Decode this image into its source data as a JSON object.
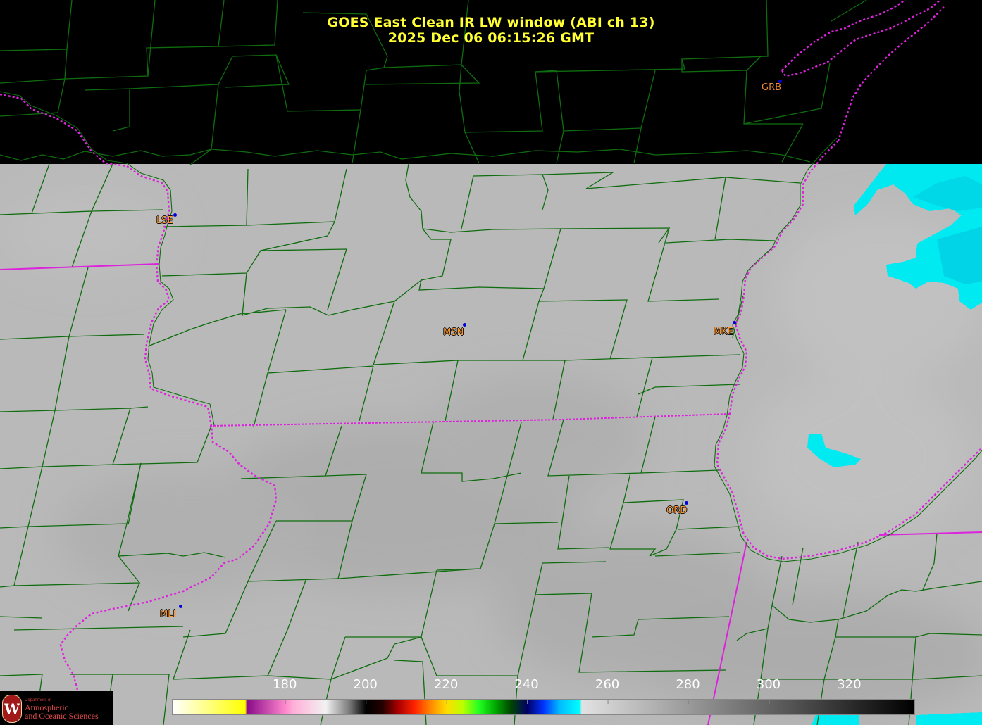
{
  "title": {
    "line1": "GOES East Clean IR LW window (ABI ch 13)",
    "line2": "2025 Dec 06  06:15:26 GMT"
  },
  "stations": [
    {
      "id": "GRB"
    },
    {
      "id": "LSE"
    },
    {
      "id": "MSN"
    },
    {
      "id": "MKE"
    },
    {
      "id": "ORD"
    },
    {
      "id": "MLI"
    }
  ],
  "colorbar": {
    "unit_range": [
      152,
      336
    ],
    "ticks": [
      "180",
      "200",
      "220",
      "240",
      "260",
      "280",
      "300",
      "320"
    ],
    "tick_values": [
      180,
      200,
      220,
      240,
      260,
      280,
      300,
      320
    ],
    "stops": [
      {
        "v": 152,
        "c": "#ffffff"
      },
      {
        "v": 170,
        "c": "#ffff00"
      },
      {
        "v": 170.5,
        "c": "#8a0a8a"
      },
      {
        "v": 180,
        "c": "#ff88cc"
      },
      {
        "v": 182,
        "c": "#ffb0d8"
      },
      {
        "v": 190,
        "c": "#f2f2f2"
      },
      {
        "v": 196,
        "c": "#777777"
      },
      {
        "v": 200,
        "c": "#000000"
      },
      {
        "v": 204,
        "c": "#220000"
      },
      {
        "v": 208,
        "c": "#aa0000"
      },
      {
        "v": 212,
        "c": "#ff2200"
      },
      {
        "v": 216,
        "c": "#ff8800"
      },
      {
        "v": 220,
        "c": "#ffdd00"
      },
      {
        "v": 224,
        "c": "#bbff00"
      },
      {
        "v": 228,
        "c": "#22ff22"
      },
      {
        "v": 232,
        "c": "#00aa00"
      },
      {
        "v": 236,
        "c": "#004400"
      },
      {
        "v": 240,
        "c": "#000066"
      },
      {
        "v": 244,
        "c": "#0033ff"
      },
      {
        "v": 248,
        "c": "#00bbff"
      },
      {
        "v": 253,
        "c": "#00ffff"
      },
      {
        "v": 253.5,
        "c": "#e2e2e2"
      },
      {
        "v": 336,
        "c": "#000000"
      }
    ]
  },
  "logo": {
    "dept": "Department of",
    "line1": "Atmospheric",
    "line2": "and Oceanic Sciences"
  },
  "colors": {
    "title": "#ffff33",
    "county_lines": "#0f6d0f",
    "state_lines": "#e020e0",
    "cloud_free_gray": "#b8b8b8",
    "cold_cloud_cyan": "#00ffff",
    "station_label": "#ff9933",
    "station_dot": "#0000dd"
  }
}
